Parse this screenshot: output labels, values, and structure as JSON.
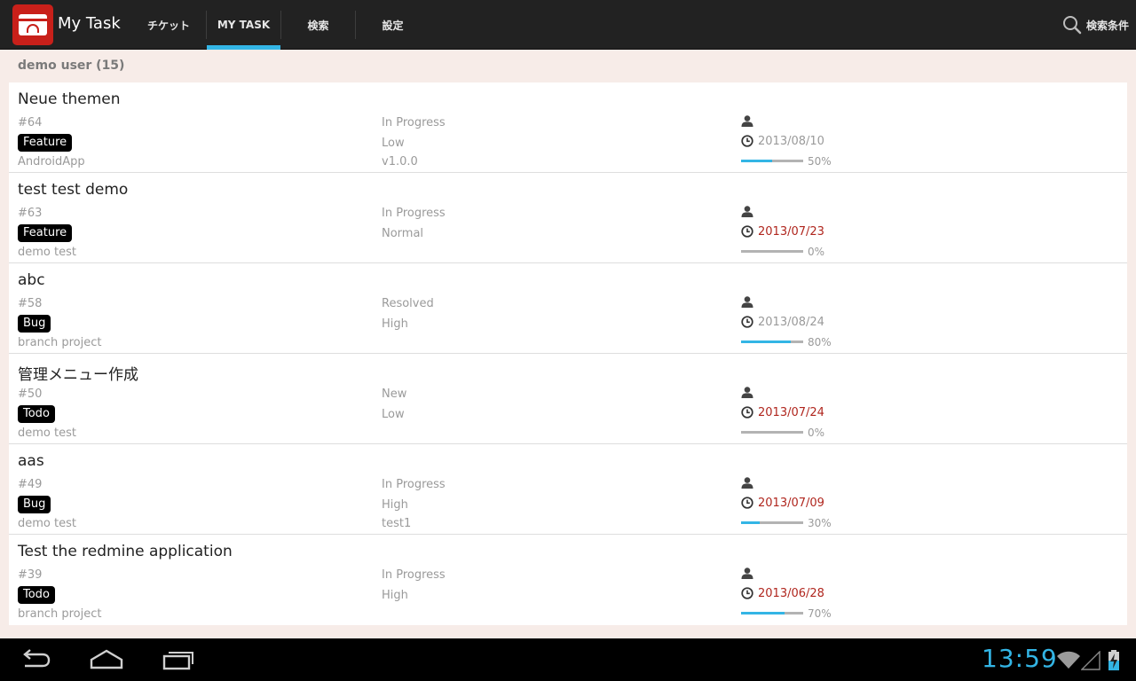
{
  "app": {
    "title": "My Task",
    "icon": "redmine-card-icon"
  },
  "tabs": [
    {
      "label": "チケット",
      "active": false
    },
    {
      "label": "MY TASK",
      "active": true
    },
    {
      "label": "検索",
      "active": false
    },
    {
      "label": "設定",
      "active": false
    }
  ],
  "search": {
    "label": "検索条件",
    "icon": "search-icon"
  },
  "group": {
    "header": "demo user (15)"
  },
  "issues": [
    {
      "title": "Neue themen",
      "id": "#64",
      "tracker": "Feature",
      "project": "AndroidApp",
      "status": "In Progress",
      "priority": "Low",
      "version": "v1.0.0",
      "due_date": "2013/08/10",
      "overdue": false,
      "progress": 50,
      "progress_label": "50%"
    },
    {
      "title": "test test demo",
      "id": "#63",
      "tracker": "Feature",
      "project": "demo test",
      "status": "In Progress",
      "priority": "Normal",
      "version": "",
      "due_date": "2013/07/23",
      "overdue": true,
      "progress": 0,
      "progress_label": "0%"
    },
    {
      "title": "abc",
      "id": "#58",
      "tracker": "Bug",
      "project": "branch project",
      "status": "Resolved",
      "priority": "High",
      "version": "",
      "due_date": "2013/08/24",
      "overdue": false,
      "progress": 80,
      "progress_label": "80%"
    },
    {
      "title": "管理メニュー作成",
      "id": "#50",
      "tracker": "Todo",
      "project": "demo test",
      "status": "New",
      "priority": "Low",
      "version": "",
      "due_date": "2013/07/24",
      "overdue": true,
      "progress": 0,
      "progress_label": "0%"
    },
    {
      "title": "aas",
      "id": "#49",
      "tracker": "Bug",
      "project": "demo test",
      "status": "In Progress",
      "priority": "High",
      "version": "test1",
      "due_date": "2013/07/09",
      "overdue": true,
      "progress": 30,
      "progress_label": "30%"
    },
    {
      "title": "Test the redmine application",
      "id": "#39",
      "tracker": "Todo",
      "project": "branch project",
      "status": "In Progress",
      "priority": "High",
      "version": "",
      "due_date": "2013/06/28",
      "overdue": true,
      "progress": 70,
      "progress_label": "70%"
    }
  ],
  "system": {
    "time": "13:59",
    "icons": [
      "back-icon",
      "home-icon",
      "recent-apps-icon",
      "wifi-icon",
      "cell-signal-icon",
      "battery-charging-icon"
    ]
  },
  "colors": {
    "accent": "#33b5e5",
    "overdue": "#b0261e",
    "app_red": "#c8201a",
    "actionbar": "#222222"
  }
}
